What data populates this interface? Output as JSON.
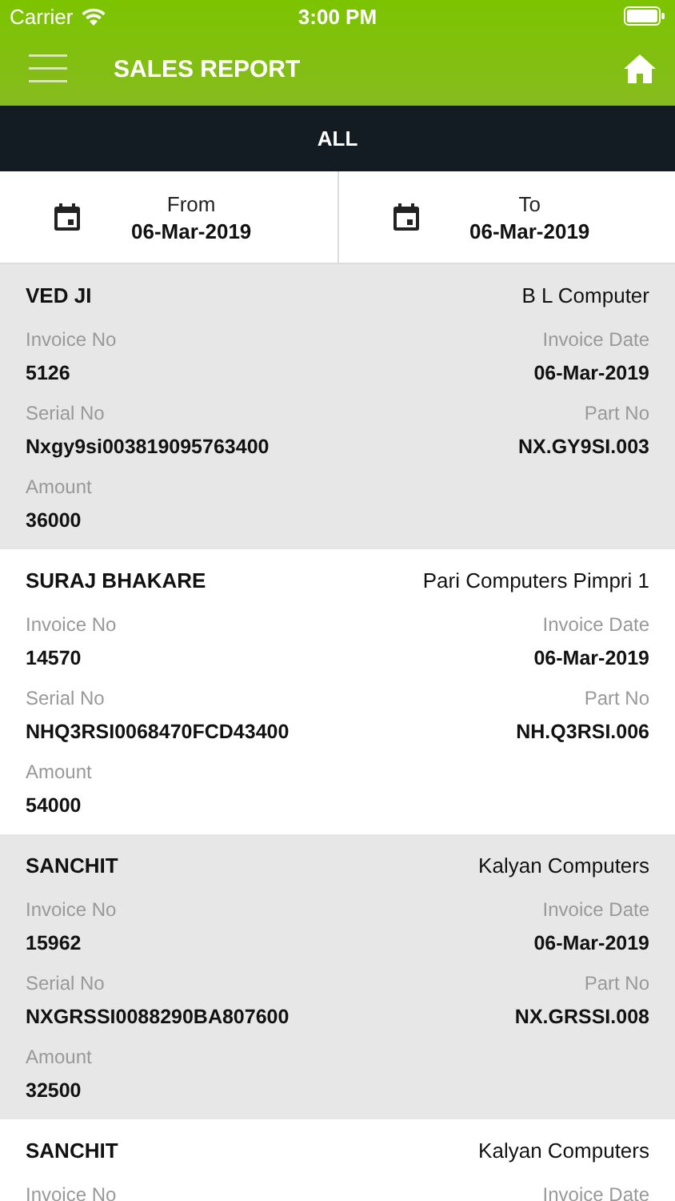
{
  "status_bar": {
    "carrier": "Carrier",
    "time": "3:00 PM"
  },
  "header": {
    "title": "SALES REPORT"
  },
  "filter": {
    "label": "ALL"
  },
  "date_range": [
    {
      "label": "From",
      "value": "06-Mar-2019"
    },
    {
      "label": "To",
      "value": "06-Mar-2019"
    }
  ],
  "records": [
    {
      "name": "VED JI",
      "dealer": "B L Computer",
      "fields": [
        {
          "label": "Invoice No",
          "value": "5126"
        },
        {
          "label": "Invoice Date",
          "value": "06-Mar-2019"
        },
        {
          "label": "Serial No",
          "value": "Nxgy9si003819095763400"
        },
        {
          "label": "Part No",
          "value": "NX.GY9SI.003"
        },
        {
          "label": "Amount",
          "value": "36000"
        }
      ]
    },
    {
      "name": "SURAJ BHAKARE",
      "dealer": "Pari Computers Pimpri 1",
      "fields": [
        {
          "label": "Invoice No",
          "value": "14570"
        },
        {
          "label": "Invoice Date",
          "value": "06-Mar-2019"
        },
        {
          "label": "Serial No",
          "value": "NHQ3RSI0068470FCD43400"
        },
        {
          "label": "Part No",
          "value": "NH.Q3RSI.006"
        },
        {
          "label": "Amount",
          "value": "54000"
        }
      ]
    },
    {
      "name": "SANCHIT",
      "dealer": "Kalyan Computers",
      "fields": [
        {
          "label": "Invoice No",
          "value": "15962"
        },
        {
          "label": "Invoice Date",
          "value": "06-Mar-2019"
        },
        {
          "label": "Serial No",
          "value": "NXGRSSI0088290BA807600"
        },
        {
          "label": "Part No",
          "value": "NX.GRSSI.008"
        },
        {
          "label": "Amount",
          "value": "32500"
        }
      ]
    },
    {
      "name": "SANCHIT",
      "dealer": "Kalyan Computers",
      "fields": [
        {
          "label": "Invoice No"
        },
        {
          "label": "Invoice Date"
        }
      ]
    }
  ]
}
